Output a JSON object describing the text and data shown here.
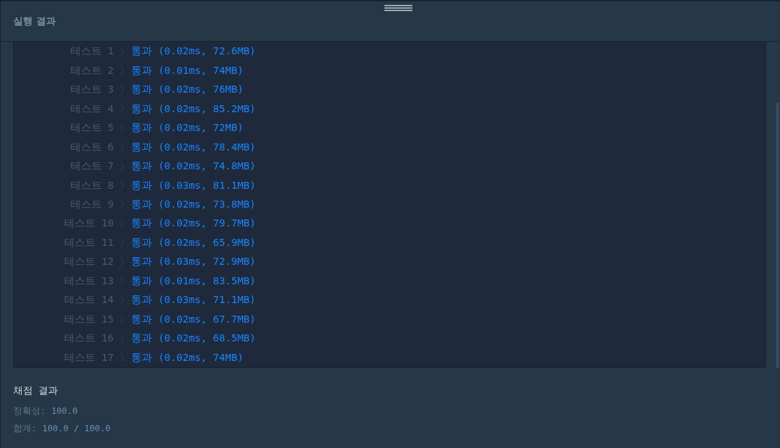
{
  "panel": {
    "title": "실행 결과"
  },
  "tests": [
    {
      "label": "테스트 1",
      "result": "통과 (0.02ms, 72.6MB)"
    },
    {
      "label": "테스트 2",
      "result": "통과 (0.01ms, 74MB)"
    },
    {
      "label": "테스트 3",
      "result": "통과 (0.02ms, 76MB)"
    },
    {
      "label": "테스트 4",
      "result": "통과 (0.02ms, 85.2MB)"
    },
    {
      "label": "테스트 5",
      "result": "통과 (0.02ms, 72MB)"
    },
    {
      "label": "테스트 6",
      "result": "통과 (0.02ms, 78.4MB)"
    },
    {
      "label": "테스트 7",
      "result": "통과 (0.02ms, 74.8MB)"
    },
    {
      "label": "테스트 8",
      "result": "통과 (0.03ms, 81.1MB)"
    },
    {
      "label": "테스트 9",
      "result": "통과 (0.02ms, 73.8MB)"
    },
    {
      "label": "테스트 10",
      "result": "통과 (0.02ms, 79.7MB)"
    },
    {
      "label": "테스트 11",
      "result": "통과 (0.02ms, 65.9MB)"
    },
    {
      "label": "테스트 12",
      "result": "통과 (0.03ms, 72.9MB)"
    },
    {
      "label": "테스트 13",
      "result": "통과 (0.01ms, 83.5MB)"
    },
    {
      "label": "테스트 14",
      "result": "통과 (0.03ms, 71.1MB)"
    },
    {
      "label": "테스트 15",
      "result": "통과 (0.02ms, 67.7MB)"
    },
    {
      "label": "테스트 16",
      "result": "통과 (0.02ms, 68.5MB)"
    },
    {
      "label": "테스트 17",
      "result": "통과 (0.02ms, 74MB)"
    }
  ],
  "grading": {
    "title": "채점 결과",
    "lines": [
      {
        "label": "정확성:",
        "value": "100.0"
      },
      {
        "label": "합계:",
        "value": "100.0 / 100.0"
      }
    ]
  }
}
